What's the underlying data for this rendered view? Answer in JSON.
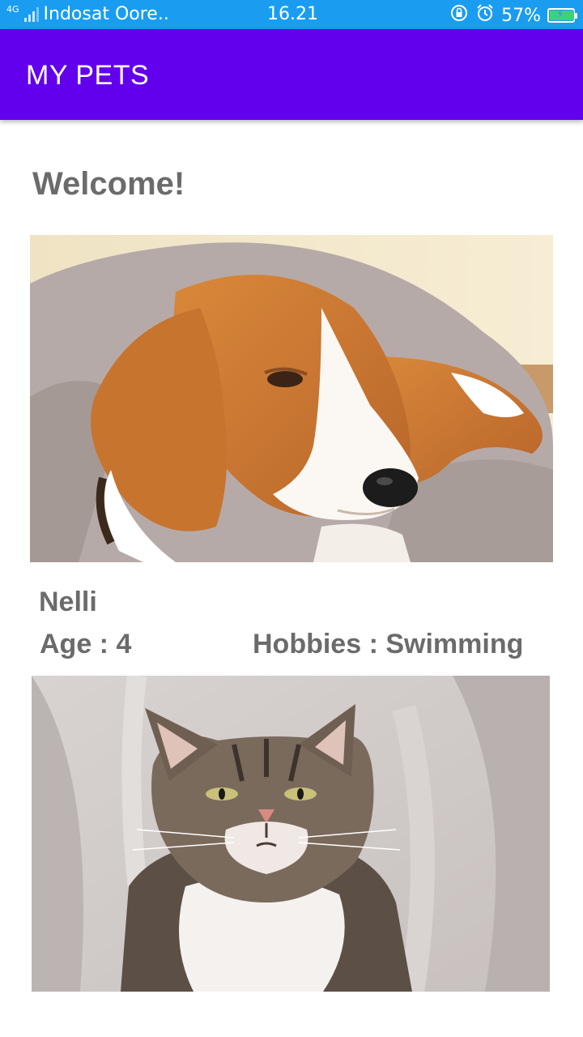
{
  "status_bar": {
    "network_type": "4G",
    "carrier": "Indosat Oore..",
    "time": "16.21",
    "battery_percent": "57%",
    "battery_level": 0.57,
    "icons": [
      "signal-icon",
      "lock-rotation-icon",
      "alarm-icon",
      "battery-charging-icon"
    ]
  },
  "app_bar": {
    "title": "MY PETS",
    "color": "#6200ee"
  },
  "main": {
    "welcome": "Welcome!",
    "pets": [
      {
        "image": "beagle-dog-photo",
        "name": "Nelli",
        "age_label": "Age : 4",
        "hobbies_label": "Hobbies : Swimming"
      },
      {
        "image": "tabby-cat-photo"
      }
    ]
  }
}
